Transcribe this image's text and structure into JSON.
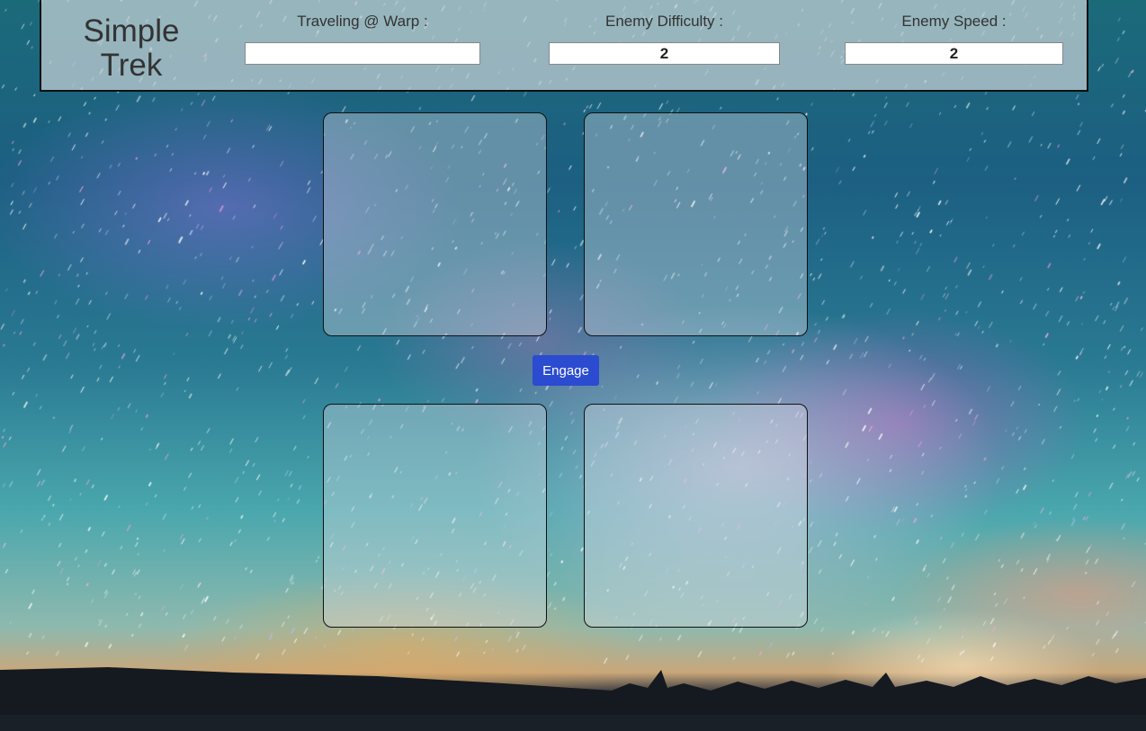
{
  "app": {
    "title_line1": "Simple",
    "title_line2": "Trek"
  },
  "controls": {
    "warp": {
      "label": "Traveling @ Warp :",
      "value": ""
    },
    "difficulty": {
      "label": "Enemy Difficulty :",
      "value": "2"
    },
    "speed": {
      "label": "Enemy Speed :",
      "value": "2"
    }
  },
  "actions": {
    "engage_label": "Engage"
  },
  "colors": {
    "accent": "#2b4bd0",
    "header_bg": "#c8d2d7",
    "text": "#333333"
  }
}
